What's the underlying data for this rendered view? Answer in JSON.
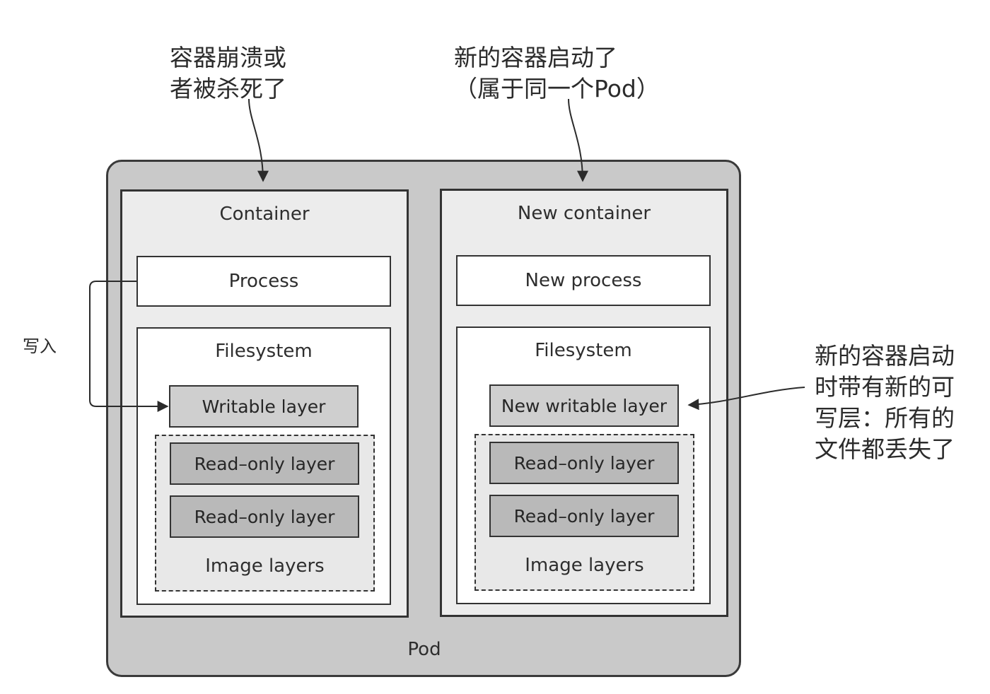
{
  "annotations": {
    "crash_note": "容器崩溃或\n者被杀死了",
    "new_container_note": "新的容器启动了\n（属于同一个Pod）",
    "write_label": "写入",
    "new_layer_note": "新的容器启动\n时带有新的可\n写层：所有的\n文件都丢失了"
  },
  "pod": {
    "label": "Pod",
    "containers": [
      {
        "title": "Container",
        "process": "Process",
        "filesystem": {
          "title": "Filesystem",
          "writable_layer": "Writable layer",
          "image_layers": {
            "title": "Image layers",
            "layers": [
              "Read–only layer",
              "Read–only layer"
            ]
          }
        }
      },
      {
        "title": "New container",
        "process": "New process",
        "filesystem": {
          "title": "Filesystem",
          "writable_layer": "New writable layer",
          "image_layers": {
            "title": "Image layers",
            "layers": [
              "Read–only layer",
              "Read–only layer"
            ]
          }
        }
      }
    ]
  }
}
